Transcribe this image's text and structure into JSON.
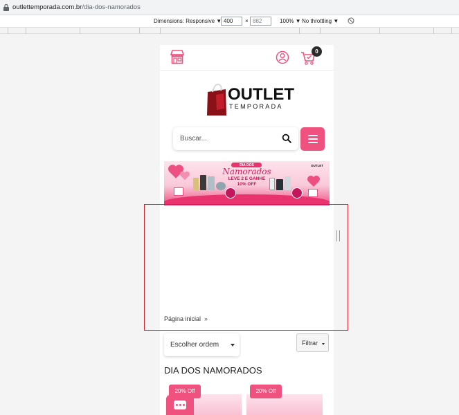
{
  "browser": {
    "url_host": "outlettemporada.com.br",
    "url_path": "/dia-dos-namorados"
  },
  "devtools": {
    "dimensions_label": "Dimensions: Responsive ▼",
    "width_value": "400",
    "times": "×",
    "height_value": "882",
    "zoom": "100% ▼",
    "throttling": "No throttling ▼"
  },
  "header": {
    "cart_count": "0"
  },
  "logo": {
    "word1": "OUTLET",
    "word2": "TEMPORADA"
  },
  "search": {
    "placeholder": "Buscar..."
  },
  "banner": {
    "line1": "DIA DOS",
    "line2": "Namorados",
    "line3": "LEVE 2 E GANHE",
    "line4": "10% OFF",
    "brand": "OUTLET"
  },
  "breadcrumb": {
    "home": "Página inicial",
    "separator": "»"
  },
  "sort": {
    "label": "Escolher ordem"
  },
  "filter": {
    "label": "Filtrar"
  },
  "section": {
    "title": "DIA DOS NAMORADOS"
  },
  "products": [
    {
      "badge": "20% Off"
    },
    {
      "badge": "20% Off"
    }
  ],
  "colors": {
    "accent": "#f0527f",
    "highlight_border": "#d0202a"
  }
}
